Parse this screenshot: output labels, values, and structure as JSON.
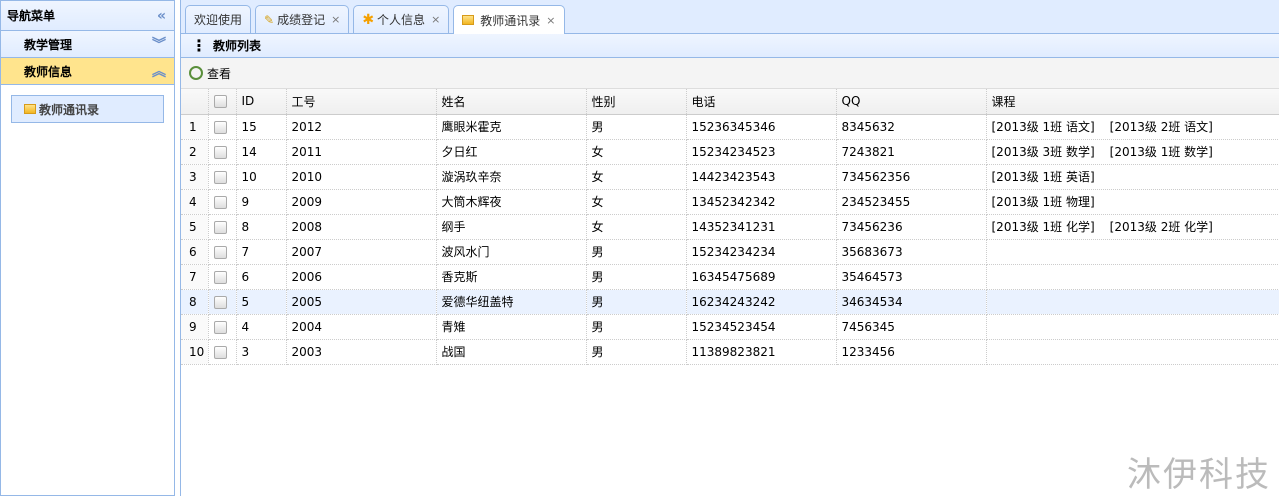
{
  "nav": {
    "title": "导航菜单",
    "sections": [
      {
        "label": "教学管理"
      },
      {
        "label": "教师信息"
      }
    ],
    "items": [
      {
        "label": "教师通讯录"
      }
    ]
  },
  "tabs": [
    {
      "label": "欢迎使用"
    },
    {
      "label": "成绩登记"
    },
    {
      "label": "个人信息"
    },
    {
      "label": "教师通讯录"
    }
  ],
  "panel": {
    "title": "教师列表",
    "view_label": "查看"
  },
  "table": {
    "headers": [
      "ID",
      "工号",
      "姓名",
      "性别",
      "电话",
      "QQ",
      "课程"
    ],
    "rows": [
      {
        "n": "1",
        "id": "15",
        "no": "2012",
        "name": "鹰眼米霍克",
        "sex": "男",
        "phone": "15236345346",
        "qq": "8345632",
        "courses": [
          "[2013级 1班 语文]",
          "[2013级 2班 语文]"
        ]
      },
      {
        "n": "2",
        "id": "14",
        "no": "2011",
        "name": "夕日红",
        "sex": "女",
        "phone": "15234234523",
        "qq": "7243821",
        "courses": [
          "[2013级 3班 数学]",
          "[2013级 1班 数学]"
        ]
      },
      {
        "n": "3",
        "id": "10",
        "no": "2010",
        "name": "漩涡玖辛奈",
        "sex": "女",
        "phone": "14423423543",
        "qq": "734562356",
        "courses": [
          "[2013级 1班 英语]"
        ]
      },
      {
        "n": "4",
        "id": "9",
        "no": "2009",
        "name": "大筒木辉夜",
        "sex": "女",
        "phone": "13452342342",
        "qq": "234523455",
        "courses": [
          "[2013级 1班 物理]"
        ]
      },
      {
        "n": "5",
        "id": "8",
        "no": "2008",
        "name": "纲手",
        "sex": "女",
        "phone": "14352341231",
        "qq": "73456236",
        "courses": [
          "[2013级 1班 化学]",
          "[2013级 2班 化学]"
        ]
      },
      {
        "n": "6",
        "id": "7",
        "no": "2007",
        "name": "波风水门",
        "sex": "男",
        "phone": "15234234234",
        "qq": "35683673",
        "courses": []
      },
      {
        "n": "7",
        "id": "6",
        "no": "2006",
        "name": "香克斯",
        "sex": "男",
        "phone": "16345475689",
        "qq": "35464573",
        "courses": []
      },
      {
        "n": "8",
        "id": "5",
        "no": "2005",
        "name": "爱德华纽盖特",
        "sex": "男",
        "phone": "16234243242",
        "qq": "34634534",
        "courses": []
      },
      {
        "n": "9",
        "id": "4",
        "no": "2004",
        "name": "青雉",
        "sex": "男",
        "phone": "15234523454",
        "qq": "7456345",
        "courses": []
      },
      {
        "n": "10",
        "id": "3",
        "no": "2003",
        "name": "战国",
        "sex": "男",
        "phone": "11389823821",
        "qq": "1233456",
        "courses": []
      }
    ],
    "highlighted_row": 8
  },
  "watermark": "沐伊科技"
}
